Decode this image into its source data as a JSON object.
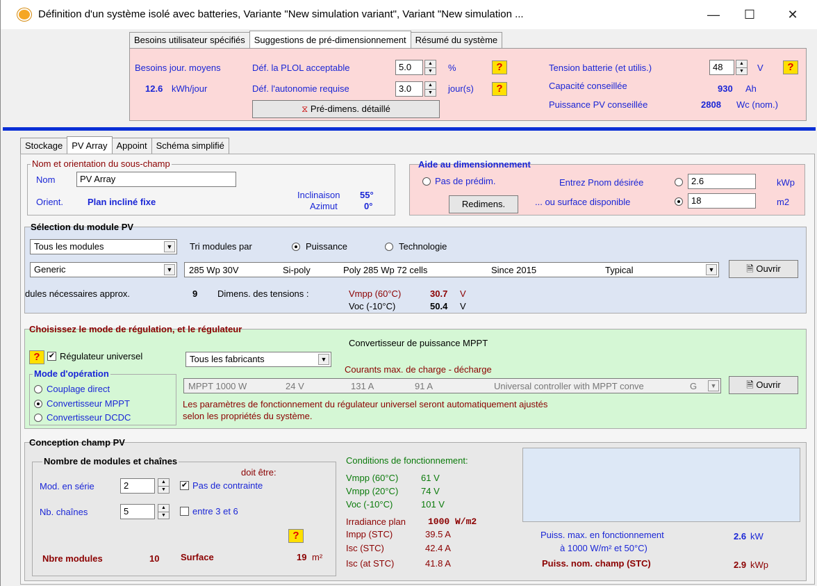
{
  "window": {
    "title": "Définition d'un système isolé avec batteries, Variante  \"New simulation variant\", Variant  \"New simulation ..."
  },
  "top_tabs": [
    "Besoins utilisateur spécifiés",
    "Suggestions de pré-dimensionnement",
    "Résumé du système"
  ],
  "presizing": {
    "needs_label": "Besoins jour. moyens",
    "needs_value": "12.6",
    "needs_unit": "kWh/jour",
    "plol_label": "Déf. la PLOL  acceptable",
    "plol_value": "5.0",
    "plol_unit": "%",
    "autonomy_label": "Déf. l'autonomie requise",
    "autonomy_value": "3.0",
    "autonomy_unit": "jour(s)",
    "detailed_button": "Pré-dimens. détaillé",
    "voltage_label": "Tension batterie (et utilis.)",
    "voltage_value": "48",
    "voltage_unit": "V",
    "capacity_label": "Capacité conseillée",
    "capacity_value": "930",
    "capacity_unit": "Ah",
    "pv_power_label": "Puissance PV conseillée",
    "pv_power_value": "2808",
    "pv_power_unit": "Wc (nom.)",
    "help": "?"
  },
  "sub_tabs": [
    "Stockage",
    "PV Array",
    "Appoint",
    "Schéma simplifié"
  ],
  "subfield": {
    "legend": "Nom et orientation du sous-champ",
    "name_label": "Nom",
    "name_value": "PV Array",
    "orient_label": "Orient.",
    "orient_value": "Plan incliné fixe",
    "tilt_label": "Inclinaison",
    "tilt_value": "55°",
    "azimuth_label": "Azimut",
    "azimuth_value": "0°"
  },
  "sizing_help": {
    "legend": "Aide au dimensionnement",
    "no_presizing": "Pas de prédim.",
    "pnom_label": "Entrez Pnom désirée",
    "pnom_value": "2.6",
    "pnom_unit": "kWp",
    "resize_button": "Redimens.",
    "area_label": "... ou surface disponible",
    "area_value": "18",
    "area_unit": "m2"
  },
  "module_selection": {
    "legend": "Sélection du module PV",
    "filter": "Tous les modules",
    "sort_label": "Tri modules par",
    "sort_power": "Puissance",
    "sort_tech": "Technologie",
    "manufacturer": "Generic",
    "module": {
      "power": "285 Wp 30V",
      "tech": "Si-poly",
      "model": "Poly 285 Wp  72 cells",
      "since": "Since 2015",
      "quality": "Typical"
    },
    "open_button": "Ouvrir",
    "approx_label": "dules nécessaires approx.",
    "approx_value": "9",
    "voltages_label": "Dimens. des tensions :",
    "vmpp_label": "Vmpp (60°C)",
    "vmpp_value": "30.7",
    "voc_label": "Voc  (-10°C)",
    "voc_value": "50.4",
    "volt_unit": "V"
  },
  "regulation": {
    "legend": "Choisissez le mode de régulation, et le régulateur",
    "universal_label": "Régulateur universel",
    "manufacturer": "Tous les fabricants",
    "mppt_title": "Convertisseur de puissance MPPT",
    "currents_title": "Courants max. de charge - décharge",
    "mode_legend": "Mode d'opération",
    "modes": [
      "Couplage direct",
      "Convertisseur MPPT",
      "Convertisseur DCDC"
    ],
    "controller": {
      "name": "MPPT 1000 W",
      "voltage": "24 V",
      "charge": "131 A",
      "discharge": "91 A",
      "description": "Universal controller with MPPT conve",
      "suffix": "G"
    },
    "open_button": "Ouvrir",
    "note": "Les paramètres de fonctionnement du régulateur universel seront automatiquement ajustés selon les propriétés du système."
  },
  "array_design": {
    "legend": "Conception champ PV",
    "sub_legend": "Nombre de modules et chaînes",
    "must_be": "doit être:",
    "series_label": "Mod. en série",
    "series_value": "2",
    "no_constraint": "Pas de contrainte",
    "strings_label": "Nb. chaînes",
    "strings_value": "5",
    "range": "entre 3 et 6",
    "nmodules_label": "Nbre modules",
    "nmodules_value": "10",
    "area_label": "Surface",
    "area_value": "19",
    "area_unit": "m²",
    "op_title": "Conditions de fonctionnement:",
    "op_rows": [
      {
        "label": "Vmpp (60°C)",
        "value": "61 V"
      },
      {
        "label": "Vmpp (20°C)",
        "value": "74 V"
      },
      {
        "label": "Voc  (-10°C)",
        "value": "101 V"
      }
    ],
    "irr_label": "Irradiance plan",
    "irr_value": "1000 W/m2",
    "stc_rows": [
      {
        "label": "Impp (STC)",
        "value": "39.5 A"
      },
      {
        "label": "Isc  (STC)",
        "value": "42.4 A"
      },
      {
        "label": "Isc  (at STC)",
        "value": "41.8 A"
      }
    ],
    "pmax_label": "Puiss. max. en fonctionnement",
    "pmax_sub": "à 1000 W/m² et 50°C)",
    "pmax_value": "2.6",
    "pmax_unit": "kW",
    "pnom_label": "Puiss. nom. champ (STC)",
    "pnom_value": "2.9",
    "pnom_unit": "kWp"
  }
}
